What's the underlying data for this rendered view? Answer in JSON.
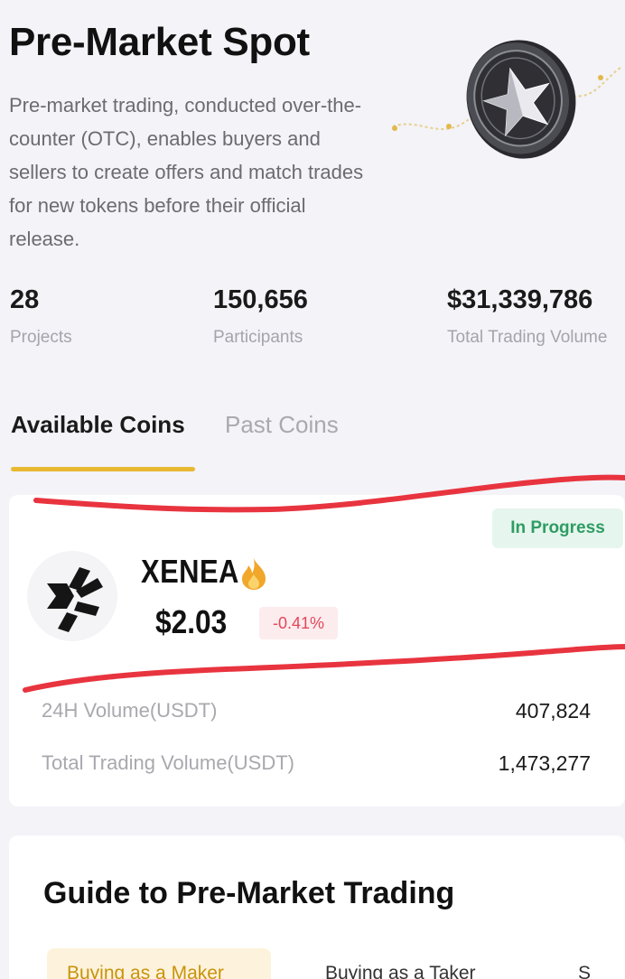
{
  "hero": {
    "title": "Pre-Market Spot",
    "description": "Pre-market trading, conducted over-the-counter (OTC), enables buyers and sellers to create offers and match trades for new tokens before their official release."
  },
  "stats": [
    {
      "value": "28",
      "label": "Projects"
    },
    {
      "value": "150,656",
      "label": "Participants"
    },
    {
      "value": "$31,339,786",
      "label": "Total Trading Volume"
    }
  ],
  "tabs": {
    "active": "Available Coins",
    "inactive": "Past Coins"
  },
  "coin": {
    "status": "In Progress",
    "name": "XENEA",
    "price": "$2.03",
    "change": "-0.41%",
    "metrics": [
      {
        "label": "24H Volume(USDT)",
        "value": "407,824"
      },
      {
        "label": "Total Trading Volume(USDT)",
        "value": "1,473,277"
      }
    ]
  },
  "guide": {
    "title": "Guide to Pre-Market Trading",
    "tabs": [
      "Buying as a Maker",
      "Buying as a Taker",
      "S"
    ]
  },
  "colors": {
    "accent": "#e8b931",
    "status_green": "#2f9c63",
    "change_red": "#e3475a",
    "annotation_red": "#e8343f"
  },
  "icons": [
    "coin-star-icon",
    "xenea-logo-icon",
    "fire-icon"
  ]
}
